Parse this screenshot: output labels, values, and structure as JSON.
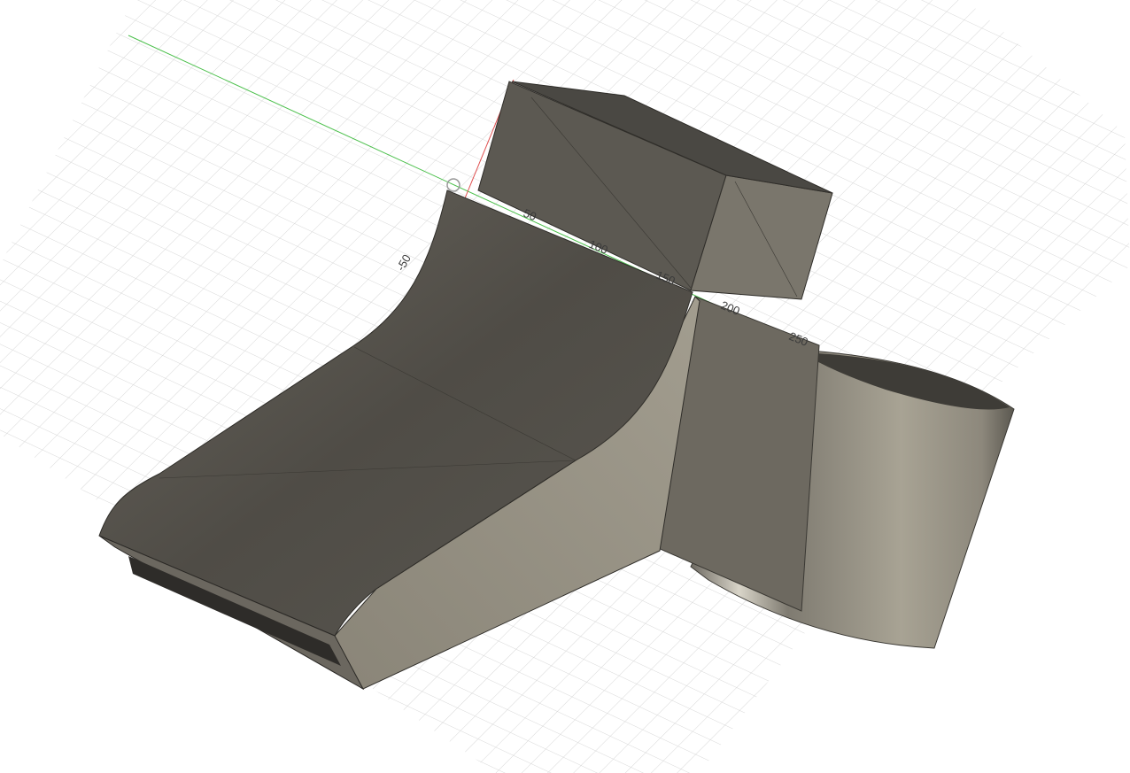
{
  "viewport": {
    "name": "3D model viewport",
    "axis_labels": [
      "50",
      "100",
      "150",
      "200",
      "250",
      "-50"
    ],
    "colors": {
      "background": "#ffffff",
      "grid": "#d9d9d9",
      "x_axis": "#4cc04c",
      "y_axis": "#e05050",
      "body_top": "#55524c",
      "body_side": "#8c877b",
      "cylinder": "#a39e90"
    }
  }
}
